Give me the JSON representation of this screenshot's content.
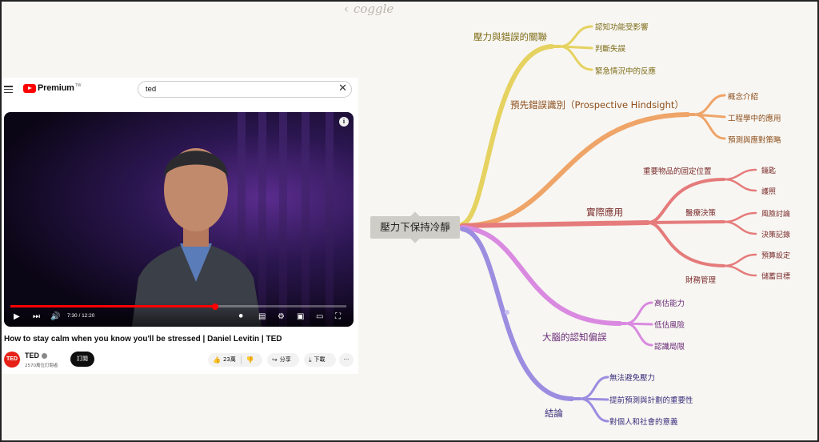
{
  "app": {
    "logo_text": "coggle",
    "back_chevron": "‹"
  },
  "youtube": {
    "brand": "Premium",
    "brand_tm": "TW",
    "search_value": "ted",
    "clear_glyph": "✕",
    "player": {
      "timecode": "7:30 / 12:20",
      "progress_fraction": 0.61,
      "info_glyph": "i"
    },
    "video_title": "How to stay calm when you know you'll be stressed | Daniel Levitin | TED",
    "channel": {
      "avatar_text": "TED",
      "name": "TED",
      "subscribers": "2570萬位訂閱者",
      "subscribe_label": "訂閱"
    },
    "actions": {
      "like_count": "23萬",
      "share_label": "分享",
      "download_label": "下載",
      "more_glyph": "···"
    }
  },
  "mindmap": {
    "central": "壓力下保持冷靜",
    "colors": {
      "yellow": "#e5d260",
      "orange": "#efa468",
      "red": "#e57b7b",
      "pink": "#d98ae0",
      "purple": "#9b8de0",
      "yellow_text": "#7d6b16",
      "orange_text": "#8e4f1c",
      "red_text": "#7a2b2b",
      "pink_text": "#6a2a78",
      "purple_text": "#3a2f7d"
    },
    "branches": {
      "stress_errors": {
        "label": "壓力與錯誤的關聯",
        "children": [
          "認知功能受影響",
          "判斷失誤",
          "緊急情況中的反應"
        ]
      },
      "prospective": {
        "label": "預先錯誤識別（Prospective Hindsight）",
        "children": [
          "概念介紹",
          "工程學中的應用",
          "預測與應對策略"
        ]
      },
      "practical": {
        "label": "實際應用",
        "subs": [
          {
            "label": "重要物品的固定位置",
            "children": [
              "鑰匙",
              "護照"
            ]
          },
          {
            "label": "醫療決策",
            "children": [
              "風險討論",
              "決策記錄"
            ]
          },
          {
            "label": "財務管理",
            "children": [
              "預算設定",
              "儲蓄目標"
            ]
          }
        ]
      },
      "bias": {
        "label": "大腦的認知偏誤",
        "children": [
          "高估能力",
          "低估風險",
          "認識局限"
        ]
      },
      "conclusion": {
        "label": "結論",
        "children": [
          "無法避免壓力",
          "提前預測與計劃的重要性",
          "對個人和社會的意義"
        ]
      }
    }
  }
}
